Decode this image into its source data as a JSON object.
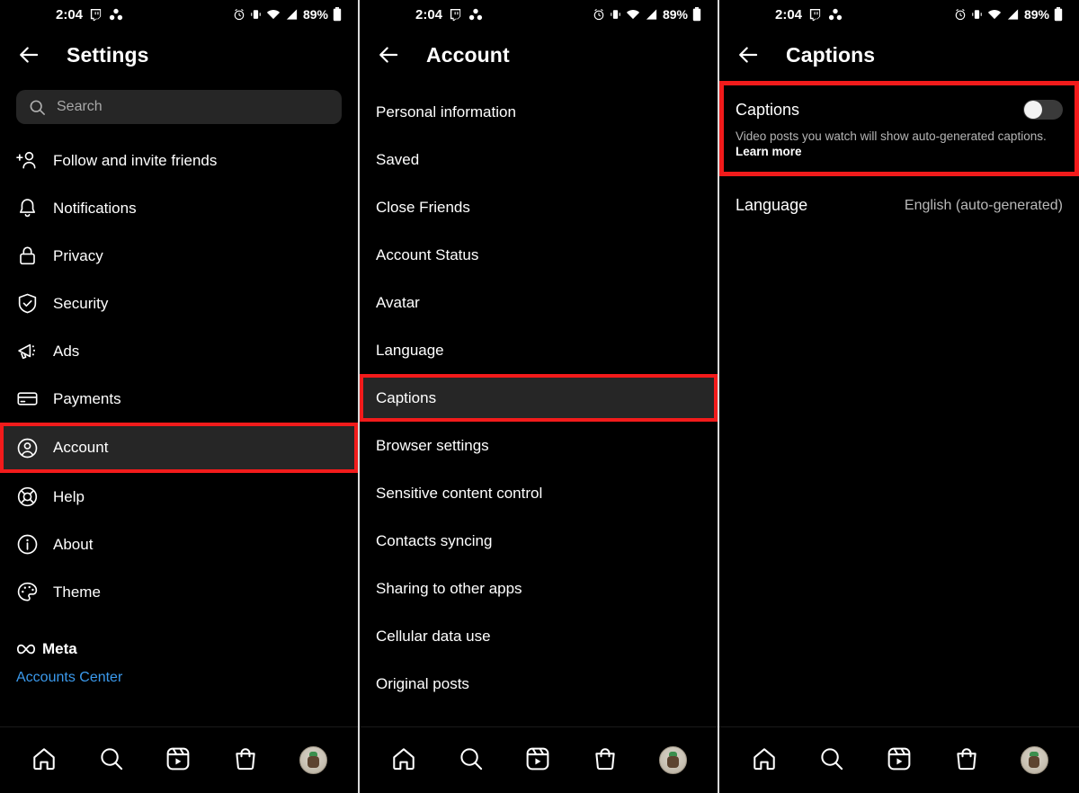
{
  "statusbar": {
    "time": "2:04",
    "battery_pct": "89%",
    "left_icons": [
      "twitch-icon",
      "three-dots-cluster-icon"
    ],
    "right_icons": [
      "alarm-icon",
      "vibrate-icon",
      "wifi-icon",
      "signal-icon",
      "battery-icon"
    ]
  },
  "panels": [
    {
      "id": "settings",
      "title": "Settings",
      "search": {
        "placeholder": "Search"
      },
      "items": [
        {
          "label": "Follow and invite friends",
          "icon": "add-person-icon",
          "highlighted": false
        },
        {
          "label": "Notifications",
          "icon": "bell-icon",
          "highlighted": false
        },
        {
          "label": "Privacy",
          "icon": "lock-icon",
          "highlighted": false
        },
        {
          "label": "Security",
          "icon": "shield-check-icon",
          "highlighted": false
        },
        {
          "label": "Ads",
          "icon": "megaphone-icon",
          "highlighted": false
        },
        {
          "label": "Payments",
          "icon": "credit-card-icon",
          "highlighted": false
        },
        {
          "label": "Account",
          "icon": "account-circle-icon",
          "highlighted": true
        },
        {
          "label": "Help",
          "icon": "lifebuoy-icon",
          "highlighted": false
        },
        {
          "label": "About",
          "icon": "info-circle-icon",
          "highlighted": false
        },
        {
          "label": "Theme",
          "icon": "palette-icon",
          "highlighted": false
        }
      ],
      "footer": {
        "meta_label": "Meta",
        "meta_icon": "meta-infinity-icon",
        "accounts_center": "Accounts Center",
        "link_color": "#3b9aed"
      }
    },
    {
      "id": "account",
      "title": "Account",
      "items": [
        {
          "label": "Personal information",
          "highlighted": false
        },
        {
          "label": "Saved",
          "highlighted": false
        },
        {
          "label": "Close Friends",
          "highlighted": false
        },
        {
          "label": "Account Status",
          "highlighted": false
        },
        {
          "label": "Avatar",
          "highlighted": false
        },
        {
          "label": "Language",
          "highlighted": false
        },
        {
          "label": "Captions",
          "highlighted": true
        },
        {
          "label": "Browser settings",
          "highlighted": false
        },
        {
          "label": "Sensitive content control",
          "highlighted": false
        },
        {
          "label": "Contacts syncing",
          "highlighted": false
        },
        {
          "label": "Sharing to other apps",
          "highlighted": false
        },
        {
          "label": "Cellular data use",
          "highlighted": false
        },
        {
          "label": "Original posts",
          "highlighted": false
        }
      ]
    },
    {
      "id": "captions",
      "title": "Captions",
      "captions_setting": {
        "label": "Captions",
        "toggle_state": "off",
        "description": "Video posts you watch will show auto-generated captions.",
        "learn_more": "Learn more"
      },
      "language_row": {
        "label": "Language",
        "value": "English (auto-generated)"
      }
    }
  ],
  "bottom_nav": {
    "items": [
      {
        "name": "home-icon"
      },
      {
        "name": "search-icon"
      },
      {
        "name": "reels-icon"
      },
      {
        "name": "shop-bag-icon"
      },
      {
        "name": "profile-avatar"
      }
    ]
  },
  "highlight_color": "#f21b1b"
}
